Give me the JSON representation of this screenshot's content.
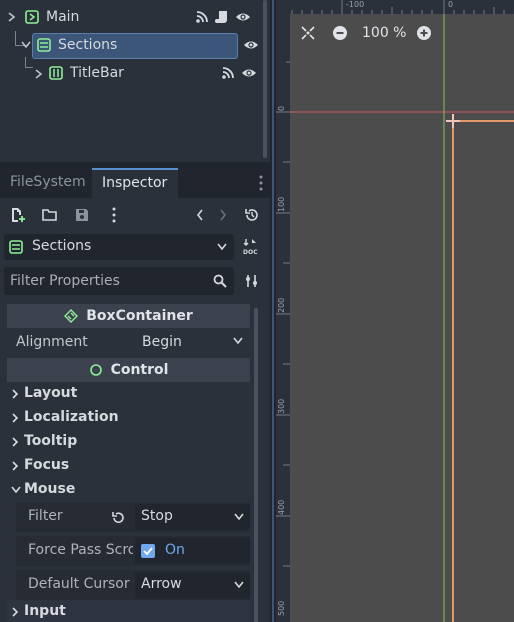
{
  "scene_tree": {
    "nodes": [
      {
        "name": "Main",
        "icon": "control-node-icon"
      },
      {
        "name": "Sections",
        "icon": "boxcontainer-node-icon",
        "selected": true
      },
      {
        "name": "TitleBar",
        "icon": "hboxcontainer-node-icon"
      }
    ]
  },
  "tabs": {
    "filesystem": "FileSystem",
    "inspector": "Inspector"
  },
  "inspector": {
    "selected_node": "Sections",
    "filter_placeholder": "Filter Properties",
    "boxcontainer_header": "BoxContainer",
    "alignment": {
      "label": "Alignment",
      "value": "Begin"
    },
    "control_header": "Control",
    "groups": {
      "layout": "Layout",
      "localization": "Localization",
      "tooltip": "Tooltip",
      "focus": "Focus",
      "mouse": "Mouse",
      "input": "Input"
    },
    "mouse": {
      "filter": {
        "label": "Filter",
        "value": "Stop"
      },
      "force_pass_scroll": {
        "label": "Force Pass Scro",
        "value": "On",
        "checked": true
      },
      "default_cursor": {
        "label": "Default Cursor",
        "value": "Arrow"
      }
    }
  },
  "viewport": {
    "zoom": "100 %",
    "ruler_top": [
      "-100",
      "0"
    ],
    "ruler_left": [
      "0",
      "100",
      "200",
      "300",
      "400",
      "500"
    ]
  },
  "colors": {
    "accent": "#5a8fd0",
    "boxcontainer_icon": "#8eef97",
    "guide_red": "#d05a63",
    "guide_green": "#7fbf5a",
    "canvas_orange": "#e3996a"
  }
}
